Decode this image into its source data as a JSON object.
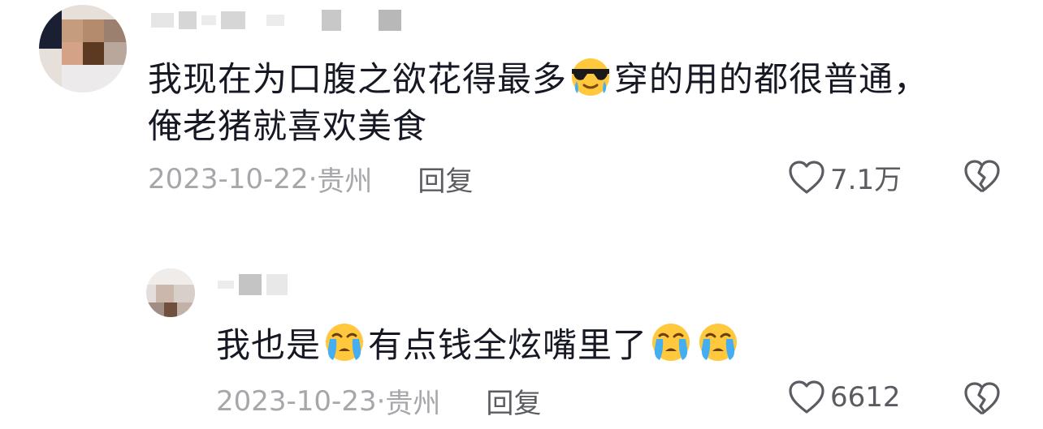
{
  "comments": [
    {
      "text_line1_a": "我现在为口腹之欲花得最多",
      "text_line1_b": "穿的用的都很普通，",
      "text_line2": "俺老猪就喜欢美食",
      "date": "2023-10-22",
      "location": "贵州",
      "reply_label": "回复",
      "likes": "7.1万",
      "emoji": [
        "cool-crying-emoji"
      ]
    },
    {
      "text_a": "我也是",
      "text_b": "有点钱全炫嘴里了",
      "date": "2023-10-23",
      "location": "贵州",
      "reply_label": "回复",
      "likes": "6612",
      "emoji": [
        "crying-emoji",
        "crying-emoji",
        "crying-emoji"
      ]
    }
  ],
  "separator": "·",
  "colors": {
    "text": "#161823",
    "meta": "#a6a7ab",
    "action": "#5b5c61",
    "emoji": "#ffc83d",
    "tear": "#45aef0"
  }
}
